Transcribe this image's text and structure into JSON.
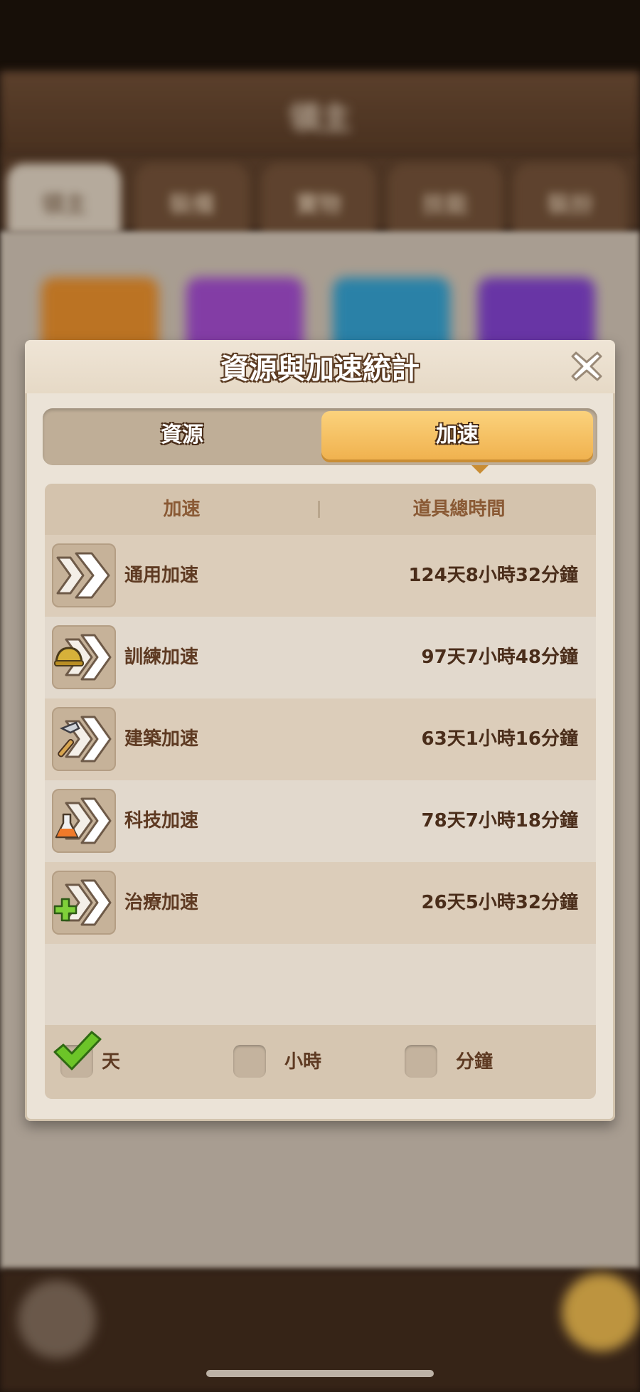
{
  "background": {
    "title": "領主",
    "tabs": [
      "領主",
      "裝備",
      "寶物",
      "技能",
      "裝扮"
    ]
  },
  "dialog": {
    "title": "資源與加速統計",
    "tabs": [
      {
        "label": "資源",
        "selected": false
      },
      {
        "label": "加速",
        "selected": true
      }
    ],
    "table": {
      "headers": [
        "加速",
        "道具總時間"
      ],
      "rows": [
        {
          "icon": "generic-speedup-icon",
          "name": "通用加速",
          "value": "124天8小時32分鐘"
        },
        {
          "icon": "training-speedup-icon",
          "name": "訓練加速",
          "value": "97天7小時48分鐘"
        },
        {
          "icon": "building-speedup-icon",
          "name": "建築加速",
          "value": "63天1小時16分鐘"
        },
        {
          "icon": "research-speedup-icon",
          "name": "科技加速",
          "value": "78天7小時18分鐘"
        },
        {
          "icon": "healing-speedup-icon",
          "name": "治療加速",
          "value": "26天5小時32分鐘"
        }
      ]
    },
    "units": [
      {
        "label": "天",
        "checked": true
      },
      {
        "label": "小時",
        "checked": false
      },
      {
        "label": "分鐘",
        "checked": false
      }
    ]
  },
  "colors": {
    "accent": "#f0b24f",
    "title_outline": "#5b3b22",
    "check_green": "#6cc428"
  }
}
